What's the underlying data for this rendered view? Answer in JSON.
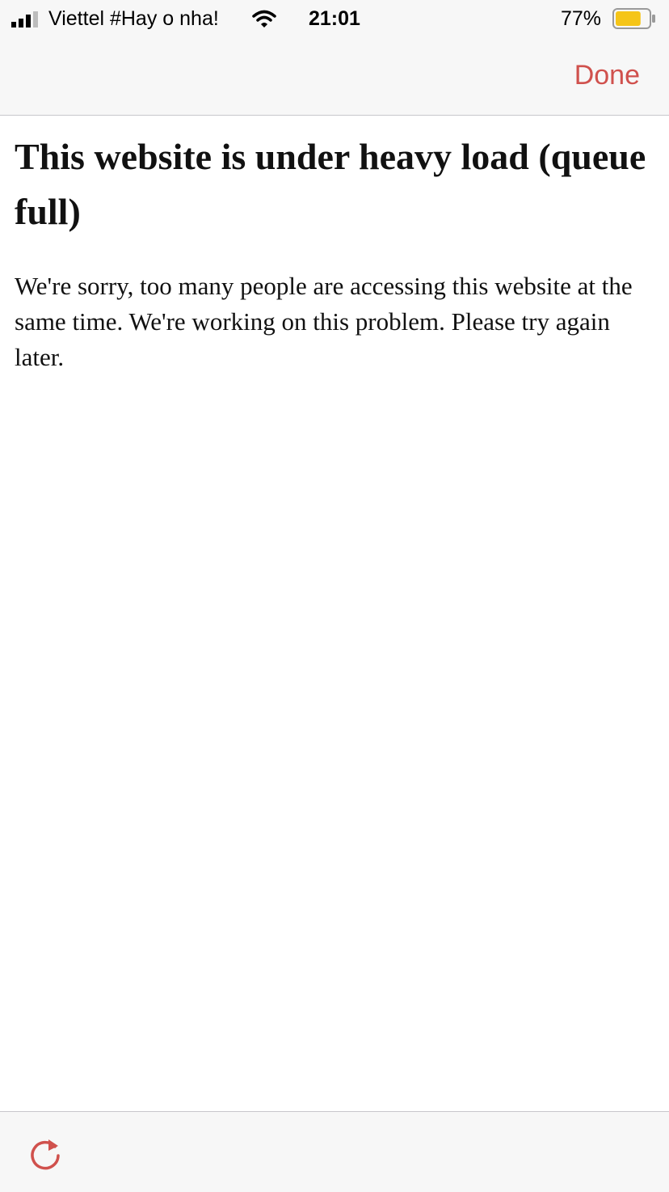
{
  "status_bar": {
    "carrier": "Viettel #Hay o nha!",
    "time": "21:01",
    "battery_percent": "77%",
    "battery_level": 0.77,
    "battery_color": "#f5c518",
    "signal_icon": "signal-bars-icon",
    "wifi_icon": "wifi-icon"
  },
  "nav_bar": {
    "done_label": "Done",
    "accent_color": "#d0514d"
  },
  "page": {
    "heading": "This website is under heavy load (queue full)",
    "message": "We're sorry, too many people are accessing this website at the same time. We're working on this problem. Please try again later."
  },
  "toolbar": {
    "reload_icon": "reload-icon"
  }
}
